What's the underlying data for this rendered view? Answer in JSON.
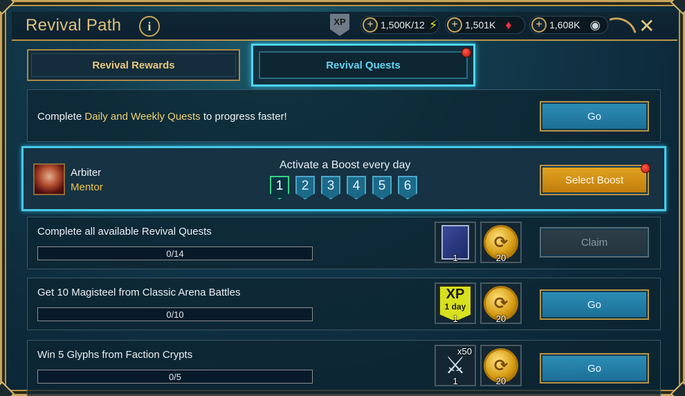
{
  "header": {
    "title": "Revival Path",
    "info_glyph": "i",
    "xp_badge": "XP",
    "currencies": [
      {
        "value": "1,500K/12",
        "icon": "energy-icon"
      },
      {
        "value": "1,501K",
        "icon": "ruby-gem-icon"
      },
      {
        "value": "1,608K",
        "icon": "silver-coin-icon"
      }
    ],
    "close_glyph": "✕"
  },
  "tabs": [
    {
      "label": "Revival Rewards",
      "active": false
    },
    {
      "label": "Revival Quests",
      "active": true
    }
  ],
  "daily": {
    "text_before": "Complete ",
    "text_highlight": "Daily and Weekly Quests",
    "text_after": " to progress faster!",
    "button_label": "Go"
  },
  "boost": {
    "mentor_name": "Arbiter",
    "mentor_role": "Mentor",
    "title": "Activate a Boost every day",
    "days": [
      "1",
      "2",
      "3",
      "4",
      "5",
      "6"
    ],
    "active_day": "1",
    "button_label": "Select Boost"
  },
  "quests": [
    {
      "title": "Complete all available Revival Quests",
      "progress": "0/14",
      "rewards": [
        {
          "icon": "tome-icon",
          "count": "1"
        },
        {
          "icon": "gold-coin-icon",
          "count": "20"
        }
      ],
      "button_label": "Claim"
    },
    {
      "title": "Get 10 Magisteel from Classic Arena Battles",
      "progress": "0/10",
      "rewards": [
        {
          "icon": "xp-boost-icon",
          "big": "XP",
          "small": "1 day",
          "count": "1"
        },
        {
          "icon": "gold-coin-icon",
          "count": "20"
        }
      ],
      "button_label": "Go"
    },
    {
      "title": "Win 5 Glyphs from Faction Crypts",
      "progress": "0/5",
      "rewards": [
        {
          "icon": "sword-icon",
          "multiplier": "x50",
          "count": "1"
        },
        {
          "icon": "gold-coin-icon",
          "count": "20"
        }
      ],
      "button_label": "Go"
    }
  ]
}
